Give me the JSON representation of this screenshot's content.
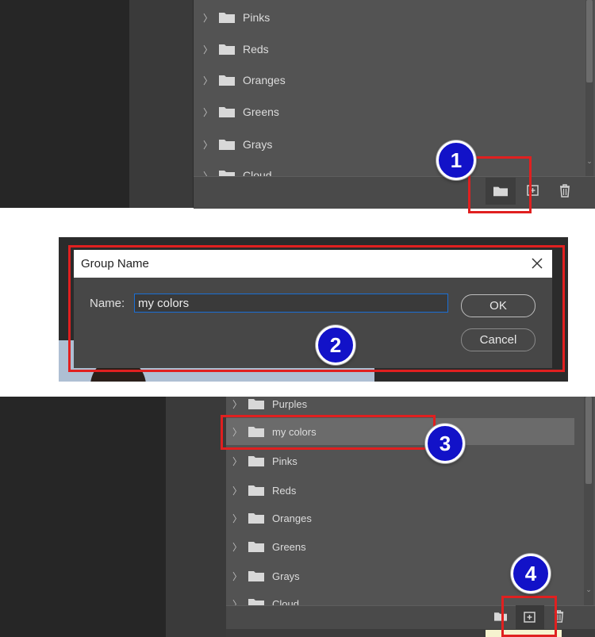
{
  "panel1": {
    "items": [
      {
        "label": "Pinks"
      },
      {
        "label": "Reds"
      },
      {
        "label": "Oranges"
      },
      {
        "label": "Greens"
      },
      {
        "label": "Grays"
      },
      {
        "label": "Cloud..."
      }
    ],
    "badge": "1"
  },
  "dialog": {
    "title": "Group Name",
    "name_label": "Name:",
    "name_value": "my colors",
    "ok_label": "OK",
    "cancel_label": "Cancel",
    "badge": "2"
  },
  "panel3": {
    "items": [
      {
        "label": "Purples"
      },
      {
        "label": "my colors"
      },
      {
        "label": "Pinks"
      },
      {
        "label": "Reds"
      },
      {
        "label": "Oranges"
      },
      {
        "label": "Greens"
      },
      {
        "label": "Grays"
      },
      {
        "label": "Cloud..."
      }
    ],
    "badge3": "3",
    "badge4": "4"
  },
  "colors": {
    "panel_bg": "#535353",
    "dark_bg": "#262626",
    "selected_row": "#6b6b6b",
    "annotation_red": "#e02020",
    "badge_blue": "#1212c8"
  }
}
